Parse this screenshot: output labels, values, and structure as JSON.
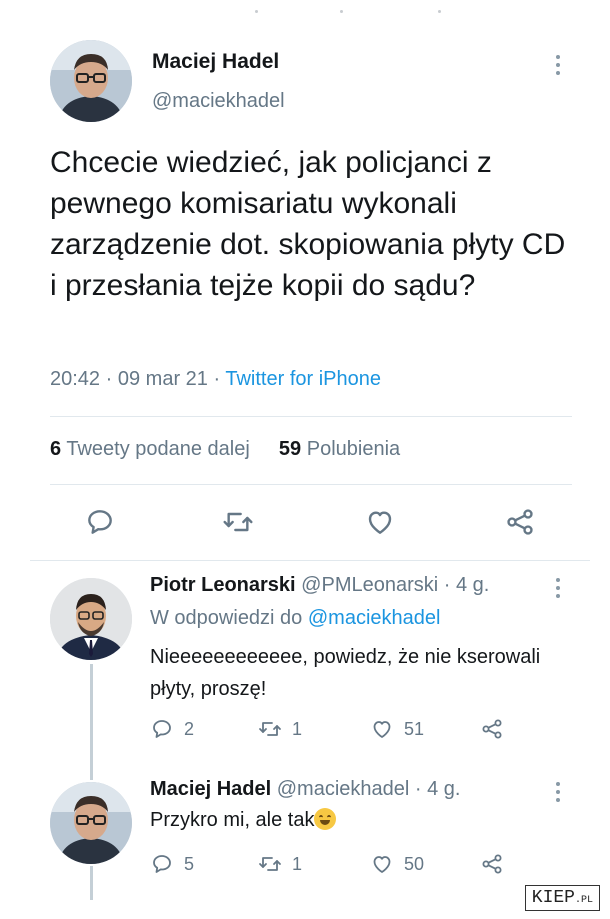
{
  "main_tweet": {
    "author_name": "Maciej Hadel",
    "author_handle": "@maciekhadel",
    "text": "Chcecie wiedzieć, jak policjanci z pewnego komisariatu wykonali zarządzenie dot. skopiowania płyty CD i przesłania tejże kopii do sądu?",
    "time": "20:42",
    "date": "09 mar 21",
    "separator": "·",
    "source": "Twitter for iPhone",
    "retweets_count": "6",
    "retweets_label": "Tweety podane dalej",
    "likes_count": "59",
    "likes_label": "Polubienia",
    "actions": [
      "reply-icon",
      "retweet-icon",
      "like-icon",
      "share-icon"
    ]
  },
  "replies": [
    {
      "author_name": "Piotr Leonarski",
      "author_handle": "@PMLeonarski",
      "age": "· 4 g.",
      "replying_prefix": "W odpowiedzi do",
      "replying_handle": "@maciekhadel",
      "text": "Nieeeeeeeeeeee, powiedz, że nie kserowali płyty, proszę!",
      "reply_count": "2",
      "retweet_count": "1",
      "like_count": "51"
    },
    {
      "author_name": "Maciej Hadel",
      "author_handle": "@maciekhadel",
      "age": "· 4 g.",
      "text": "Przykro mi, ale tak",
      "emoji": "face-with-tears-of-joy",
      "reply_count": "5",
      "retweet_count": "1",
      "like_count": "50"
    }
  ],
  "watermark": {
    "main": "KIEP",
    "suffix": ".PL"
  },
  "colors": {
    "accent": "#1b95e0",
    "secondary_text": "#657786",
    "primary_text": "#14171a",
    "divider": "#e1e8ed"
  }
}
